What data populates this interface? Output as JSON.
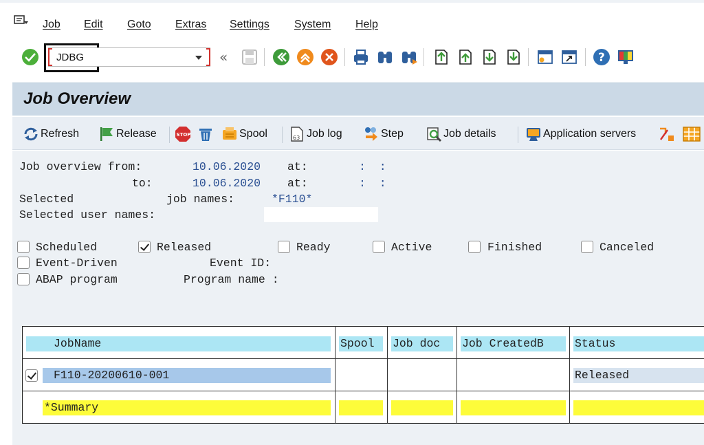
{
  "menu": {
    "items": [
      {
        "label": "Job"
      },
      {
        "label": "Edit"
      },
      {
        "label": "Goto"
      },
      {
        "label": "Extras"
      },
      {
        "label": "Settings"
      },
      {
        "label": "System"
      },
      {
        "label": "Help"
      }
    ]
  },
  "toolbar": {
    "command_value": "JDBG",
    "icons": [
      "enter-icon",
      "back-arrows-icon",
      "save-icon",
      "back-icon",
      "exit-icon",
      "cancel-icon",
      "print-icon",
      "find-icon",
      "find-next-icon",
      "first-page-icon",
      "previous-page-icon",
      "next-page-icon",
      "last-page-icon",
      "create-session-icon",
      "shortcut-icon",
      "help-icon",
      "customize-layout-icon"
    ]
  },
  "title": "Job Overview",
  "app_toolbar": {
    "refresh": "Refresh",
    "release": "Release",
    "spool": "Spool",
    "job_log": "Job log",
    "step": "Step",
    "job_details": "Job details",
    "app_servers": "Application servers"
  },
  "criteria": {
    "from_label": "Job overview from:",
    "from_date": "10.06.2020",
    "at_label": "at:",
    "time_sep": ":  :",
    "to_label": "to:",
    "to_date": "10.06.2020",
    "selected_label": "Selected",
    "job_names_label": "job names:",
    "job_names_value": "*F110*",
    "user_names_label": "Selected user names:",
    "user_names_value": ""
  },
  "status_filters": {
    "scheduled": {
      "label": "Scheduled",
      "checked": false
    },
    "released": {
      "label": "Released",
      "checked": true
    },
    "ready": {
      "label": "Ready",
      "checked": false
    },
    "active": {
      "label": "Active",
      "checked": false
    },
    "finished": {
      "label": "Finished",
      "checked": false
    },
    "canceled": {
      "label": "Canceled",
      "checked": false
    },
    "event_driven": {
      "label": "Event-Driven",
      "checked": false
    },
    "event_id_label": "Event ID:",
    "abap_program": {
      "label": "ABAP program",
      "checked": false
    },
    "program_name_label": "Program name :"
  },
  "grid": {
    "columns": [
      "JobName",
      "Spool",
      "Job doc",
      "Job CreatedB",
      "Status"
    ],
    "rows": [
      {
        "selected": true,
        "job_name": "F110-20200610-001",
        "spool": "",
        "job_doc": "",
        "created_by": "",
        "status": "Released"
      }
    ],
    "summary_label": "*Summary"
  }
}
